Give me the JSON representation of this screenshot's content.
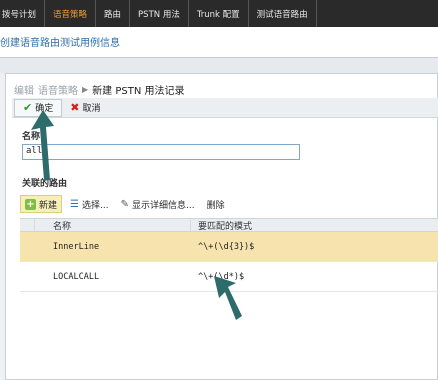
{
  "topnav": {
    "tabs": [
      {
        "label": "拨号计划",
        "active": false
      },
      {
        "label": "语音策略",
        "active": true
      },
      {
        "label": "路由",
        "active": false
      },
      {
        "label": "PSTN 用法",
        "active": false
      },
      {
        "label": "Trunk 配置",
        "active": false
      },
      {
        "label": "测试语音路由",
        "active": false
      }
    ]
  },
  "header": {
    "title": "创建语音路由测试用例信息"
  },
  "breadcrumb": {
    "items": [
      "编辑",
      "语音策略"
    ],
    "current": "新建 PSTN 用法记录"
  },
  "toolbar": {
    "ok_label": "确定",
    "cancel_label": "取消"
  },
  "form": {
    "name_label": "名称",
    "name_value": "all",
    "assoc_label": "关联的路由"
  },
  "grid_toolbar": {
    "add_label": "新建",
    "select_label": "选择...",
    "details_label": "显示详细信息...",
    "delete_label": "删除"
  },
  "grid": {
    "columns": [
      "名称",
      "要匹配的模式"
    ],
    "rows": [
      {
        "marker": "",
        "name": "InnerLine",
        "pattern": "^\\+(\\d{3})$",
        "selected": true
      },
      {
        "marker": "",
        "name": "LOCALCALL",
        "pattern": "^\\+(\\d*)$",
        "selected": false
      }
    ]
  },
  "colors": {
    "nav_bg": "#2a2a2a",
    "nav_active": "#f0a030",
    "header_title": "#2d6ea8",
    "selected_row": "#f6e3ae",
    "arrow": "#2e6b6b"
  }
}
